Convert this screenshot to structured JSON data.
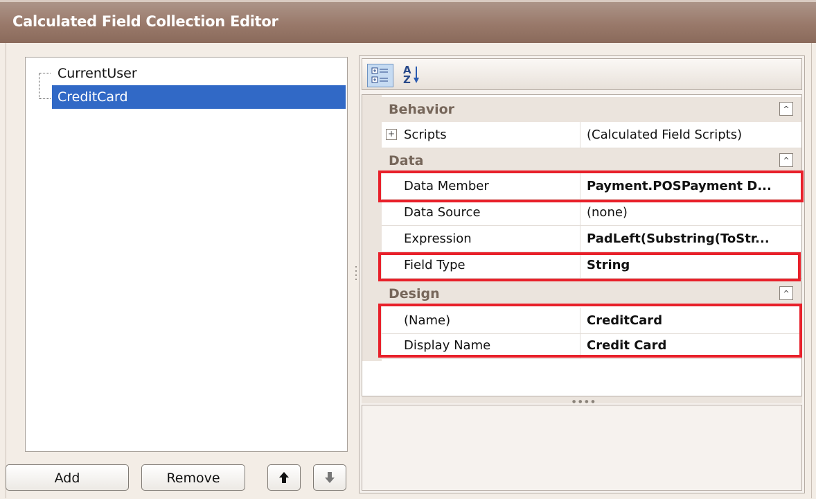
{
  "window": {
    "title": "Calculated Field Collection Editor"
  },
  "tree": {
    "items": [
      {
        "label": "CurrentUser",
        "selected": false
      },
      {
        "label": "CreditCard",
        "selected": true
      }
    ]
  },
  "buttons": {
    "add": "Add",
    "remove": "Remove",
    "move_up_icon": "arrow-up-icon",
    "move_down_icon": "arrow-down-icon"
  },
  "toolbar": {
    "categorized_icon": "categorized-view-icon",
    "alphabetical_icon": "sort-alphabetical-icon",
    "alphabetical_glyph_top": "A",
    "alphabetical_glyph_bottom": "Z"
  },
  "property_grid": {
    "categories": [
      {
        "name": "Behavior",
        "collapse_glyph": "^",
        "properties": [
          {
            "name": "Scripts",
            "value": "(Calculated Field Scripts)",
            "expandable": true,
            "expander": "+",
            "bold": false
          }
        ]
      },
      {
        "name": "Data",
        "collapse_glyph": "^",
        "properties": [
          {
            "name": "Data Member",
            "value": "Payment.POSPayment D...",
            "bold": true,
            "highlighted": true
          },
          {
            "name": "Data Source",
            "value": "(none)",
            "bold": false
          },
          {
            "name": "Expression",
            "value": "PadLeft(Substring(ToStr...",
            "bold": true
          },
          {
            "name": "Field Type",
            "value": "String",
            "bold": true,
            "highlighted": true
          }
        ]
      },
      {
        "name": "Design",
        "collapse_glyph": "^",
        "properties": [
          {
            "name": "(Name)",
            "value": "CreditCard",
            "bold": true,
            "highlighted": true
          },
          {
            "name": "Display Name",
            "value": "Credit Card",
            "bold": true,
            "highlighted": true
          }
        ]
      }
    ]
  },
  "colors": {
    "title_bar": "#99796a",
    "selection": "#3169c6",
    "highlight_box": "#e8202a",
    "category_text": "#76665a"
  }
}
